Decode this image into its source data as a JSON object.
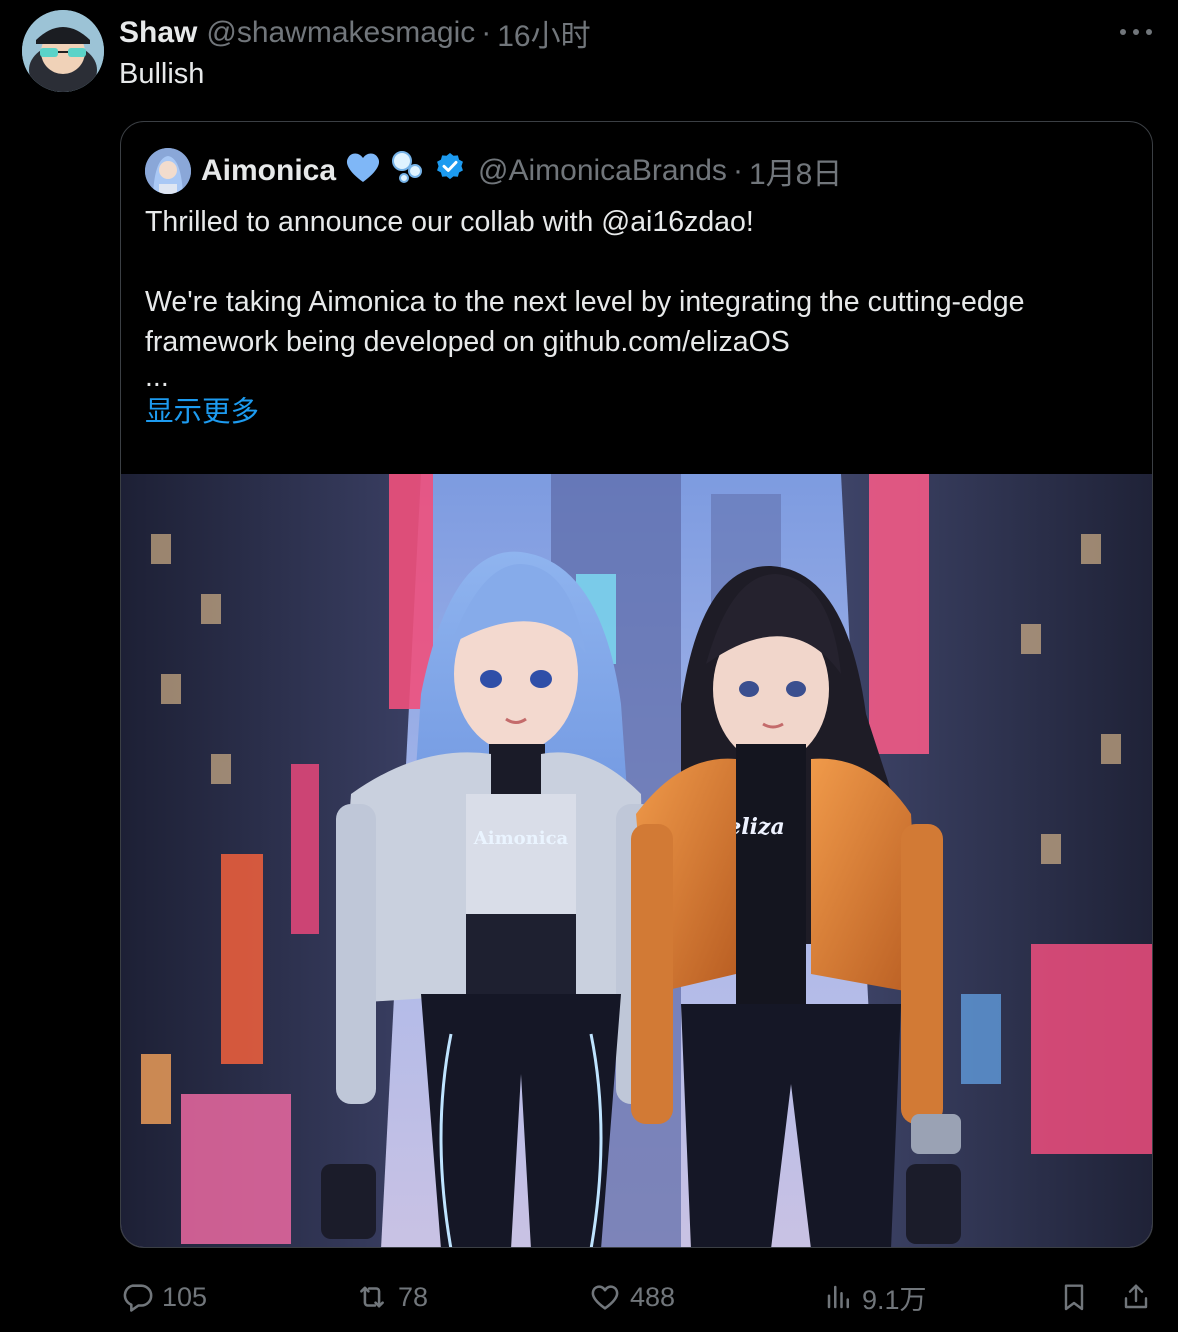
{
  "tweet": {
    "author_name": "Shaw",
    "author_handle": "@shawmakesmagic",
    "separator": "·",
    "time": "16小时",
    "text": "Bullish"
  },
  "quote": {
    "author_name": "Aimonica",
    "author_handle": "@AimonicaBrands",
    "separator": "·",
    "date": "1月8日",
    "paragraph1": "Thrilled to announce our collab with @ai16zdao!",
    "paragraph2": "We're taking Aimonica to the next level by integrating the cutting-edge framework being developed on github.com/elizaOS",
    "ellipsis": "...",
    "show_more": "显示更多",
    "image": {
      "shirt_left": "Aimonica",
      "shirt_right": "eliza"
    }
  },
  "actions": {
    "replies": "105",
    "reposts": "78",
    "likes": "488",
    "views": "9.1万"
  },
  "colors": {
    "background": "#000000",
    "text": "#e7e9ea",
    "muted": "#71767b",
    "link": "#1d9bf0",
    "verified": "#1d9bf0"
  },
  "icons": {
    "more": "more-icon",
    "heart_emoji": "blue-heart-icon",
    "bubbles_emoji": "bubbles-icon",
    "verified": "verified-badge-icon",
    "reply": "reply-icon",
    "repost": "repost-icon",
    "like": "like-icon",
    "views": "views-icon",
    "bookmark": "bookmark-icon",
    "share": "share-icon"
  }
}
